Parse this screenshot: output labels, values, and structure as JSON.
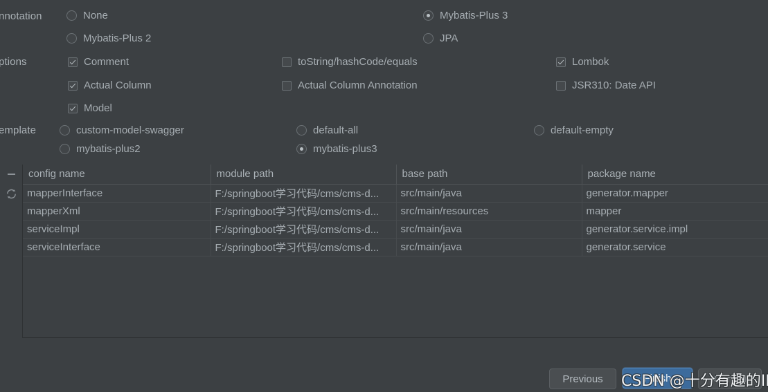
{
  "sections": {
    "annotation_label": "nnotation",
    "options_label": "ptions",
    "template_label": "emplate"
  },
  "annotation": {
    "options": [
      {
        "label": "None",
        "selected": false
      },
      {
        "label": "Mybatis-Plus 2",
        "selected": false
      },
      {
        "label": "Mybatis-Plus 3",
        "selected": true
      },
      {
        "label": "JPA",
        "selected": false
      }
    ]
  },
  "options": {
    "items": [
      {
        "label": "Comment",
        "checked": true
      },
      {
        "label": "Actual Column",
        "checked": true
      },
      {
        "label": "Model",
        "checked": true
      },
      {
        "label": "toString/hashCode/equals",
        "checked": false
      },
      {
        "label": "Actual Column Annotation",
        "checked": false
      },
      {
        "label": "Lombok",
        "checked": true
      },
      {
        "label": "JSR310: Date API",
        "checked": false
      }
    ]
  },
  "template": {
    "options": [
      {
        "label": "custom-model-swagger",
        "selected": false
      },
      {
        "label": "mybatis-plus2",
        "selected": false
      },
      {
        "label": "default-all",
        "selected": false
      },
      {
        "label": "mybatis-plus3",
        "selected": true
      },
      {
        "label": "default-empty",
        "selected": false
      }
    ]
  },
  "table_toolbar": {
    "remove_icon": "minus-icon",
    "reset_icon": "refresh-icon"
  },
  "table": {
    "columns": [
      "config name",
      "module path",
      "base path",
      "package name"
    ],
    "rows": [
      {
        "config_name": "mapperInterface",
        "module_path": "F:/springboot学习代码/cms/cms-d...",
        "base_path": "src/main/java",
        "package_name": "generator.mapper"
      },
      {
        "config_name": "mapperXml",
        "module_path": "F:/springboot学习代码/cms/cms-d...",
        "base_path": "src/main/resources",
        "package_name": "mapper"
      },
      {
        "config_name": "serviceImpl",
        "module_path": "F:/springboot学习代码/cms/cms-d...",
        "base_path": "src/main/java",
        "package_name": "generator.service.impl"
      },
      {
        "config_name": "serviceInterface",
        "module_path": "F:/springboot学习代码/cms/cms-d...",
        "base_path": "src/main/java",
        "package_name": "generator.service"
      }
    ]
  },
  "footer": {
    "previous_label": "Previous",
    "finish_label": "Finish",
    "cancel_label": "Cancel"
  },
  "watermark": {
    "text": "CSDN @十分有趣的ID"
  },
  "colors": {
    "background": "#3c4043",
    "text": "#a6adb2",
    "accent": "#3c6b9c",
    "grid_line": "#4f5356"
  }
}
